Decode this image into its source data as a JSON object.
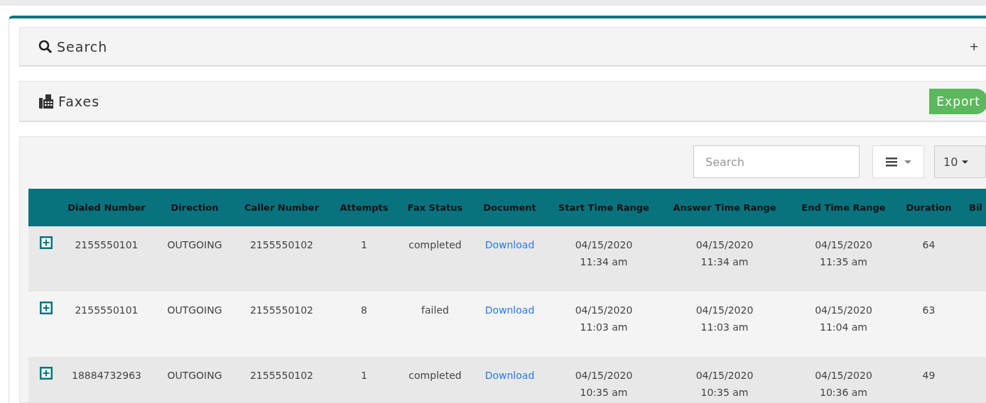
{
  "search_panel": {
    "title": "Search",
    "toggle": "+"
  },
  "faxes_panel": {
    "title": "Faxes",
    "export_button": "Export"
  },
  "toolbar": {
    "search": {
      "placeholder": "Search"
    },
    "page_size": "10"
  },
  "table": {
    "columns": [
      "",
      "Dialed Number",
      "Direction",
      "Caller Number",
      "Attempts",
      "Fax Status",
      "Document",
      "Start Time Range",
      "Answer Time Range",
      "End Time Range",
      "Duration",
      "Bil"
    ],
    "rows": [
      {
        "dialed_number": "2155550101",
        "direction": "OUTGOING",
        "caller_number": "2155550102",
        "attempts": "1",
        "fax_status": "completed",
        "document": "Download",
        "start_time": "04/15/2020 11:34 am",
        "answer_time": "04/15/2020 11:34 am",
        "end_time": "04/15/2020 11:35 am",
        "duration": "64"
      },
      {
        "dialed_number": "2155550101",
        "direction": "OUTGOING",
        "caller_number": "2155550102",
        "attempts": "8",
        "fax_status": "failed",
        "document": "Download",
        "start_time": "04/15/2020 11:03 am",
        "answer_time": "04/15/2020 11:03 am",
        "end_time": "04/15/2020 11:04 am",
        "duration": "63"
      },
      {
        "dialed_number": "18884732963",
        "direction": "OUTGOING",
        "caller_number": "2155550102",
        "attempts": "1",
        "fax_status": "completed",
        "document": "Download",
        "start_time": "04/15/2020 10:35 am",
        "answer_time": "04/15/2020 10:35 am",
        "end_time": "04/15/2020 10:36 am",
        "duration": "49"
      }
    ]
  }
}
